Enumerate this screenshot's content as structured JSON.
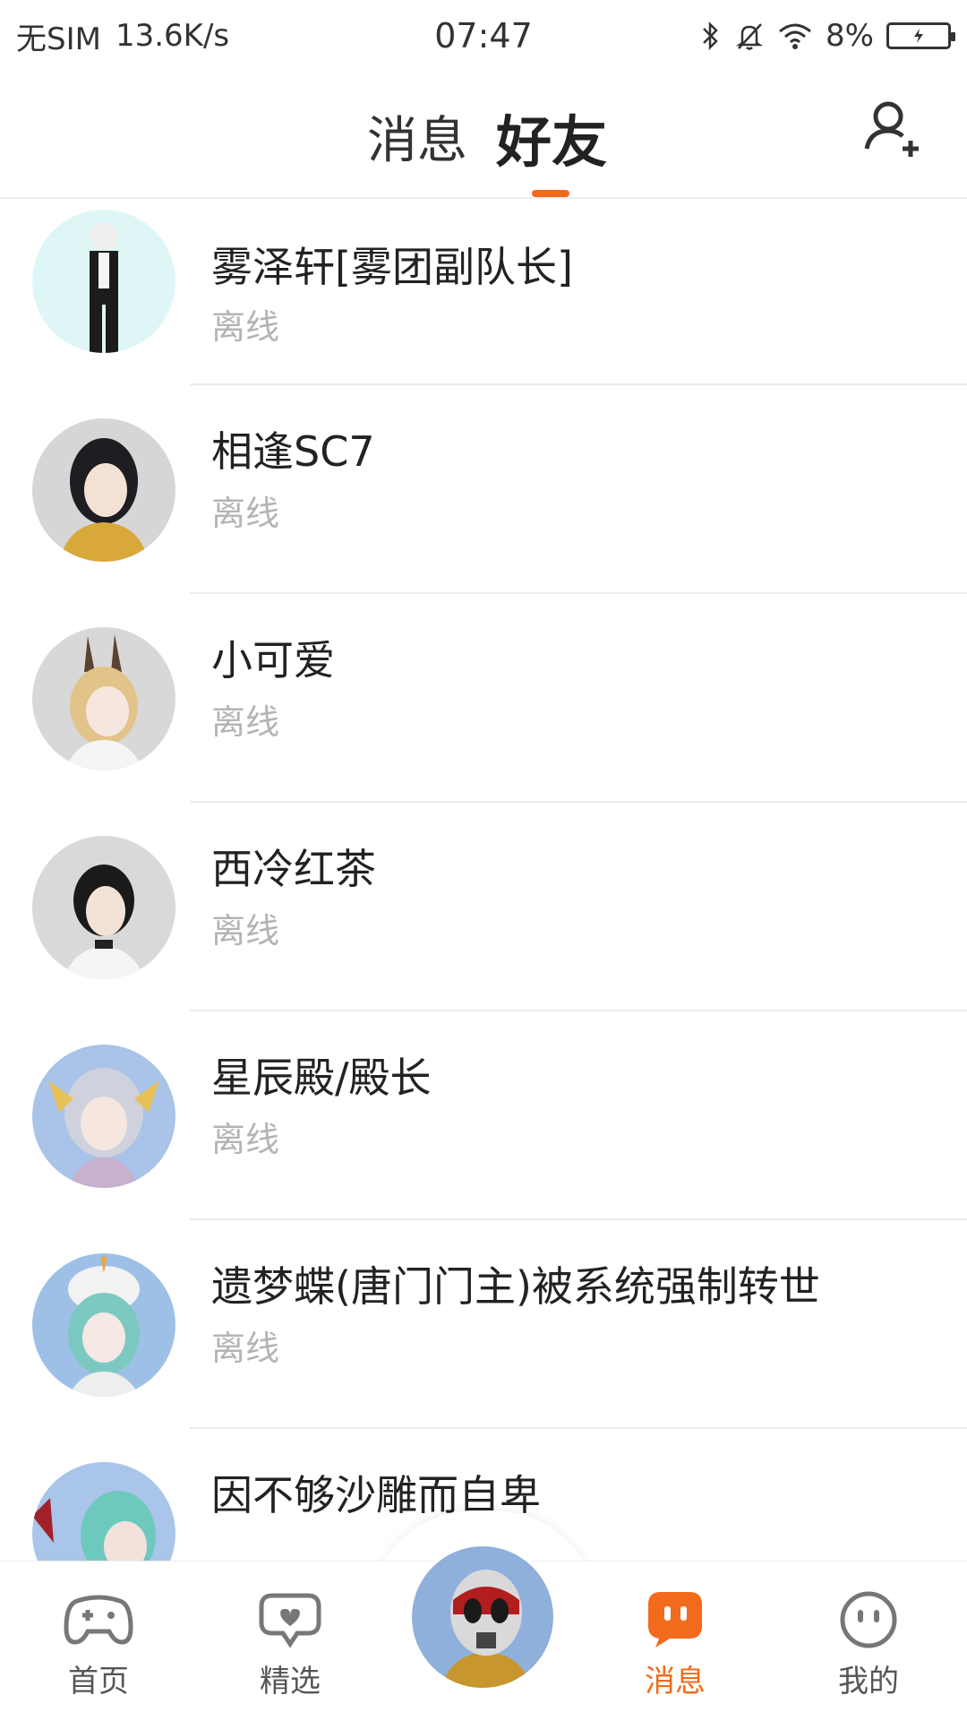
{
  "status_bar": {
    "carrier": "无SIM",
    "speed": "13.6K/s",
    "time": "07:47",
    "battery": "8%"
  },
  "header": {
    "tabs": [
      {
        "label": "消息",
        "active": false
      },
      {
        "label": "好友",
        "active": true
      }
    ],
    "add_friend_icon": "add-person-icon"
  },
  "friends": [
    {
      "name": "雾泽轩[雾团副队长]",
      "status": "离线"
    },
    {
      "name": "相逢SC7",
      "status": "离线"
    },
    {
      "name": "小可爱",
      "status": "离线"
    },
    {
      "name": "西冷红茶",
      "status": "离线"
    },
    {
      "name": "星辰殿/殿长",
      "status": "离线"
    },
    {
      "name": "遗梦蝶(唐门门主)被系统强制转世",
      "status": "离线"
    },
    {
      "name": "因不够沙雕而自卑",
      "status": ""
    }
  ],
  "bottom_nav": {
    "items": [
      {
        "label": "首页",
        "icon": "gamepad-icon",
        "active": false
      },
      {
        "label": "精选",
        "icon": "heart-chat-icon",
        "active": false
      },
      {
        "label": "消息",
        "icon": "message-bubble-icon",
        "active": true
      },
      {
        "label": "我的",
        "icon": "smiley-icon",
        "active": false
      }
    ]
  },
  "colors": {
    "accent": "#f26a1b",
    "offline_text": "#b4b4b4",
    "divider": "#ececec"
  }
}
